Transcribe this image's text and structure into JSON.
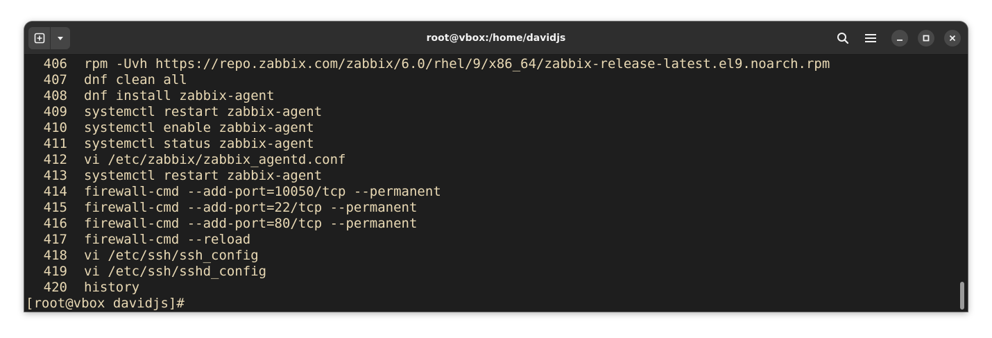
{
  "window": {
    "title": "root@vbox:/home/davidjs"
  },
  "toolbar": {
    "new_tab_icon": "new-tab-icon",
    "tab_menu_icon": "chevron-down-icon",
    "search_icon": "search-icon",
    "menu_icon": "hamburger-menu-icon",
    "minimize_icon": "minimize-icon",
    "maximize_icon": "maximize-icon",
    "close_icon": "close-icon"
  },
  "terminal": {
    "text_color": "#e9d9b4",
    "background": "#1e1e1e",
    "history": [
      {
        "num": "406",
        "cmd": "rpm -Uvh https://repo.zabbix.com/zabbix/6.0/rhel/9/x86_64/zabbix-release-latest.el9.noarch.rpm"
      },
      {
        "num": "407",
        "cmd": "dnf clean all"
      },
      {
        "num": "408",
        "cmd": "dnf install zabbix-agent"
      },
      {
        "num": "409",
        "cmd": "systemctl restart zabbix-agent"
      },
      {
        "num": "410",
        "cmd": "systemctl enable zabbix-agent"
      },
      {
        "num": "411",
        "cmd": "systemctl status zabbix-agent"
      },
      {
        "num": "412",
        "cmd": "vi /etc/zabbix/zabbix_agentd.conf"
      },
      {
        "num": "413",
        "cmd": "systemctl restart zabbix-agent"
      },
      {
        "num": "414",
        "cmd": "firewall-cmd --add-port=10050/tcp --permanent"
      },
      {
        "num": "415",
        "cmd": "firewall-cmd --add-port=22/tcp --permanent"
      },
      {
        "num": "416",
        "cmd": "firewall-cmd --add-port=80/tcp --permanent"
      },
      {
        "num": "417",
        "cmd": "firewall-cmd --reload"
      },
      {
        "num": "418",
        "cmd": "vi /etc/ssh/ssh_config"
      },
      {
        "num": "419",
        "cmd": "vi /etc/ssh/sshd_config"
      },
      {
        "num": "420",
        "cmd": "history"
      }
    ],
    "prompt": "[root@vbox davidjs]#"
  }
}
